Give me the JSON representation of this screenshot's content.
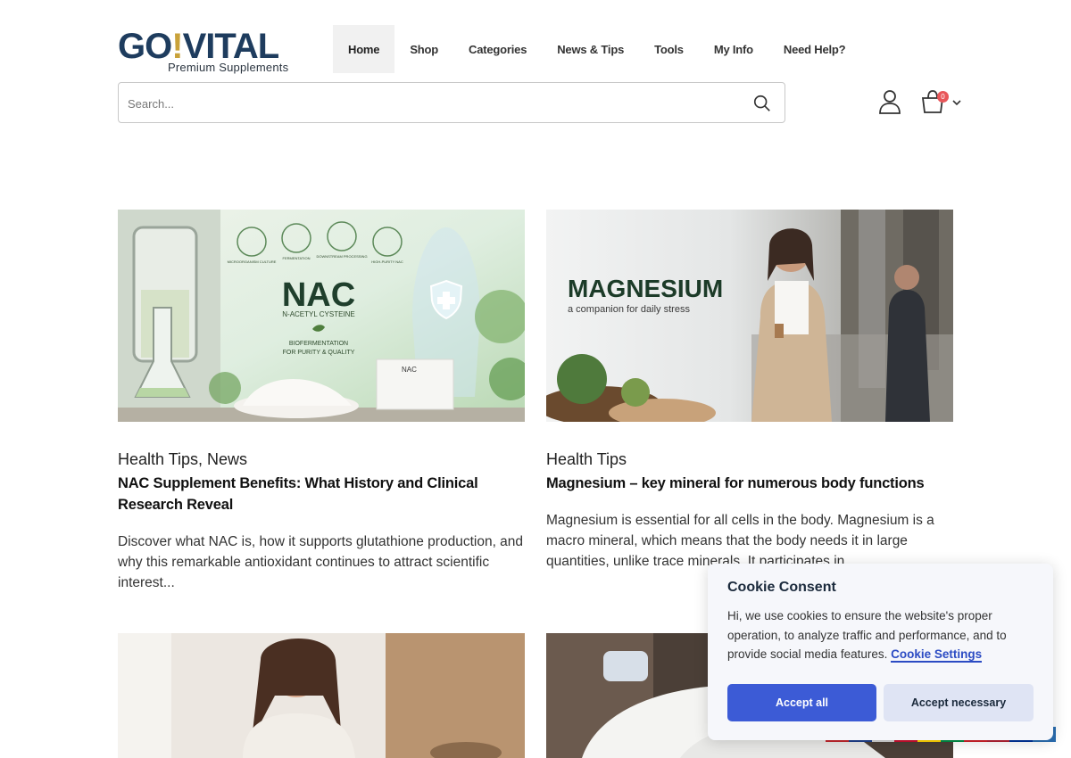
{
  "logo": {
    "main_prefix": "GO",
    "main_bang": "!",
    "main_suffix": "VITAL",
    "tagline": "Premium Supplements"
  },
  "nav": {
    "items": [
      {
        "label": "Home",
        "active": true
      },
      {
        "label": "Shop"
      },
      {
        "label": "Categories"
      },
      {
        "label": "News & Tips"
      },
      {
        "label": "Tools"
      },
      {
        "label": "My Info"
      },
      {
        "label": "Need Help?"
      }
    ]
  },
  "search": {
    "placeholder": "Search...",
    "icon": "search-icon"
  },
  "account": {
    "icon": "user-icon"
  },
  "cart": {
    "count": "0",
    "icon": "cart-icon"
  },
  "posts": [
    {
      "image": {
        "heading": "NAC",
        "subheading": "N-ACETYL CYSTEINE",
        "tagline_1": "BIOFERMENTATION",
        "tagline_2": "FOR PURITY & QUALITY",
        "steps": [
          "MICROORGANISM CULTURE",
          "FERMENTATION",
          "DOWNSTREAM PROCESSING",
          "HIGH-PURITY NAC"
        ],
        "box_label": "NAC"
      },
      "categories": "Health Tips, News",
      "title": "NAC Supplement Benefits: What History and Clinical Research Reveal",
      "excerpt": "Discover what NAC is, how it supports glutathione production, and why this remarkable antioxidant continues to attract scientific interest..."
    },
    {
      "image": {
        "heading": "MAGNESIUM",
        "subheading": "a companion for daily stress"
      },
      "categories": "Health Tips",
      "title": "Magnesium – key mineral for numerous body functions",
      "excerpt": "Magnesium is essential for all cells in the body. Magnesium is a macro mineral, which means that the body needs it in large quantities, unlike trace minerals. It participates in..."
    }
  ],
  "cookie": {
    "title": "Cookie Consent",
    "text": "Hi, we use cookies to ensure the website's proper operation, to analyze traffic and performance, and to provide social media features.",
    "link": "Cookie Settings",
    "accept_all": "Accept all",
    "accept_necessary": "Accept necessary"
  },
  "colors": {
    "brand_navy": "#1e3c5e",
    "brand_gold": "#c9a23a",
    "accent_blue": "#3c5bd6",
    "badge_red": "#e8575a"
  }
}
